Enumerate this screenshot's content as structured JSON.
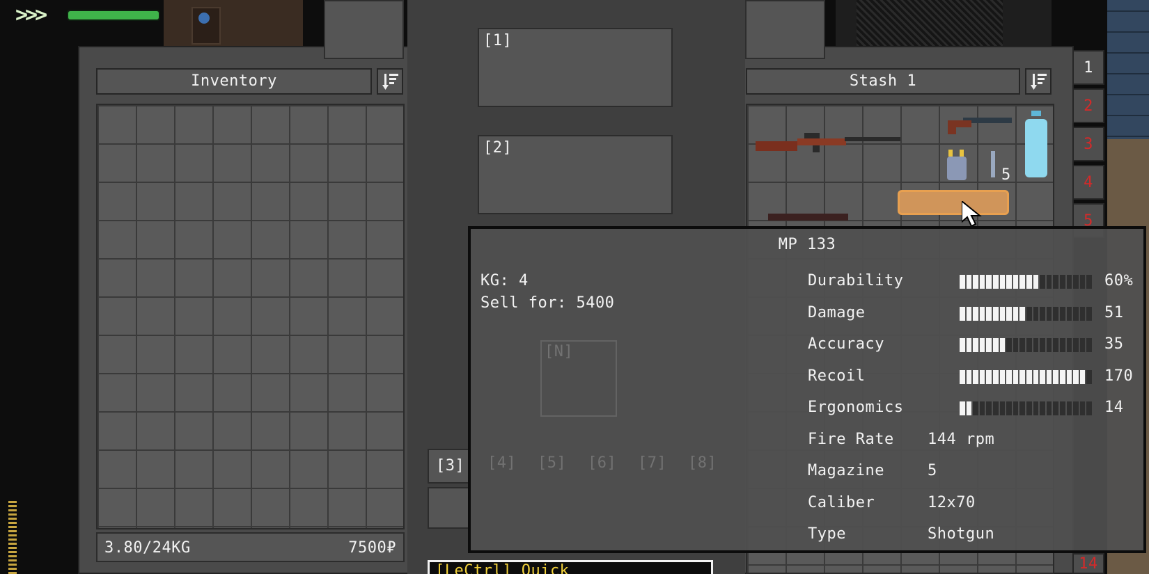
{
  "hud": {
    "speed_indicator": ">>>",
    "health_fill": 1.0
  },
  "inventory": {
    "title": "Inventory",
    "weight": "3.80/24KG",
    "money": "7500₽"
  },
  "center": {
    "slot1": "[1]",
    "slot2": "[2]",
    "slot3": "[3]",
    "slot_ghost": [
      "[N]",
      "[4]",
      "[5]",
      "[6]",
      "[7]",
      "[8]"
    ],
    "bottom_hint": "[LeCtrl] Quick"
  },
  "stash": {
    "title": "Stash 1",
    "tabs": [
      "1",
      "2",
      "3",
      "4",
      "5",
      "14"
    ],
    "item_counts": [
      "5"
    ]
  },
  "tooltip": {
    "name": "MP 133",
    "kg": "KG: 4",
    "sell": "Sell for: 5400",
    "stats": [
      {
        "label": "Durability",
        "value": "60%",
        "fill": 0.6
      },
      {
        "label": "Damage",
        "value": "51",
        "fill": 0.5
      },
      {
        "label": "Accuracy",
        "value": "35",
        "fill": 0.35
      },
      {
        "label": "Recoil",
        "value": "170",
        "fill": 0.95
      },
      {
        "label": "Ergonomics",
        "value": "14",
        "fill": 0.1
      }
    ],
    "info": [
      {
        "label": "Fire Rate",
        "value": "144 rpm"
      },
      {
        "label": "Magazine",
        "value": "5"
      },
      {
        "label": "Caliber",
        "value": "12x70"
      },
      {
        "label": "Type",
        "value": "Shotgun"
      }
    ]
  },
  "colors": {
    "accent_green": "#3fb34a",
    "tab_red": "#d42a2a",
    "highlight_orange": "#e8a050"
  }
}
